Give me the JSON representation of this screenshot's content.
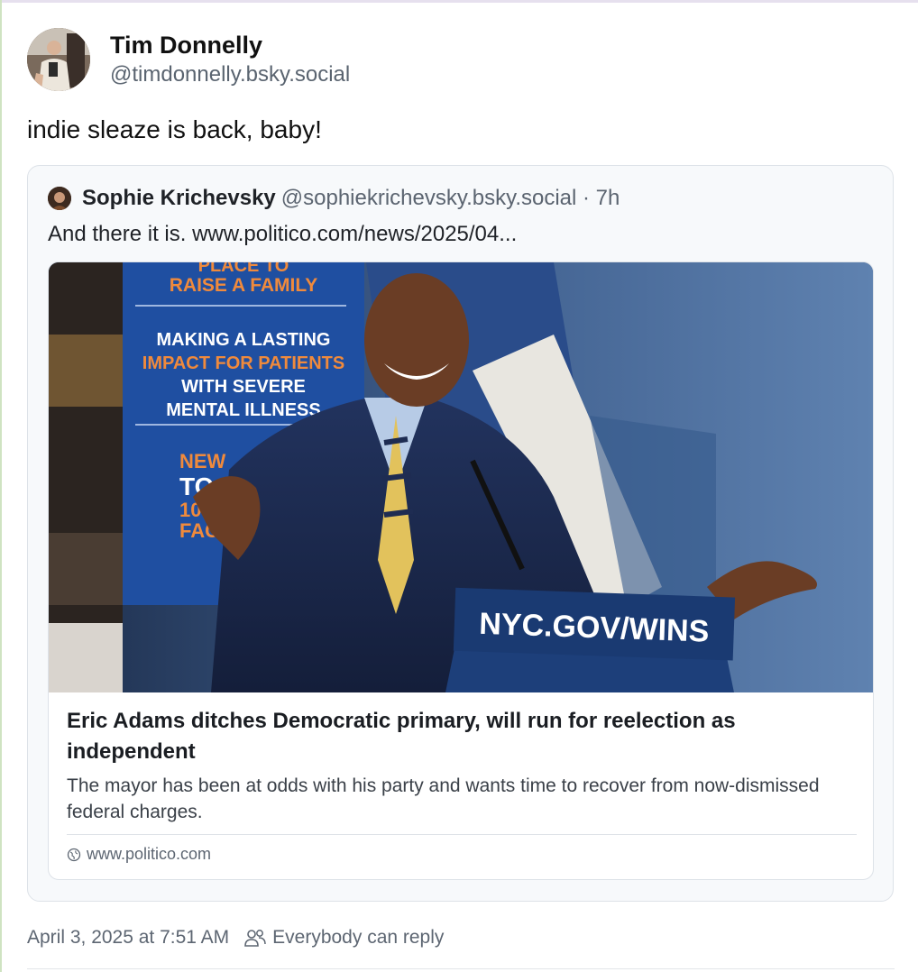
{
  "post": {
    "author_name": "Tim Donnelly",
    "author_handle": "@timdonnelly.bsky.social",
    "text": "indie sleaze is back, baby!",
    "timestamp": "April 3, 2025 at 7:51 AM",
    "reply_setting": "Everybody can reply"
  },
  "quote": {
    "author_name": "Sophie Krichevsky",
    "author_handle": "@sophiekrichevsky.bsky.social · 7h",
    "text": "And there it is. www.politico.com/news/2025/04..."
  },
  "link_card": {
    "title": "Eric Adams ditches Democratic primary, will run for reelection as independent",
    "description": "The mayor has been at odds with his party and wants time to recover from now-dismissed federal charges.",
    "domain": "www.politico.com",
    "image": {
      "banner_line1": "RAISE A FAMILY",
      "banner_line2": "MAKING A LASTING",
      "banner_line3": "IMPACT FOR PATIENTS",
      "banner_line4": "WITH SEVERE",
      "banner_line5": "MENTAL ILLNESS",
      "banner_line6": "NEW",
      "banner_line7": "TO H",
      "banner_line8": "100-P",
      "banner_line9": "FACI",
      "podium_text": "NYC.GOV/WINS"
    }
  },
  "icons": {
    "globe": "globe-icon",
    "people": "people-icon"
  },
  "colors": {
    "handle_gray": "#5a6470",
    "card_border": "#dde2e8",
    "podium_blue": "#1d3f7a"
  }
}
